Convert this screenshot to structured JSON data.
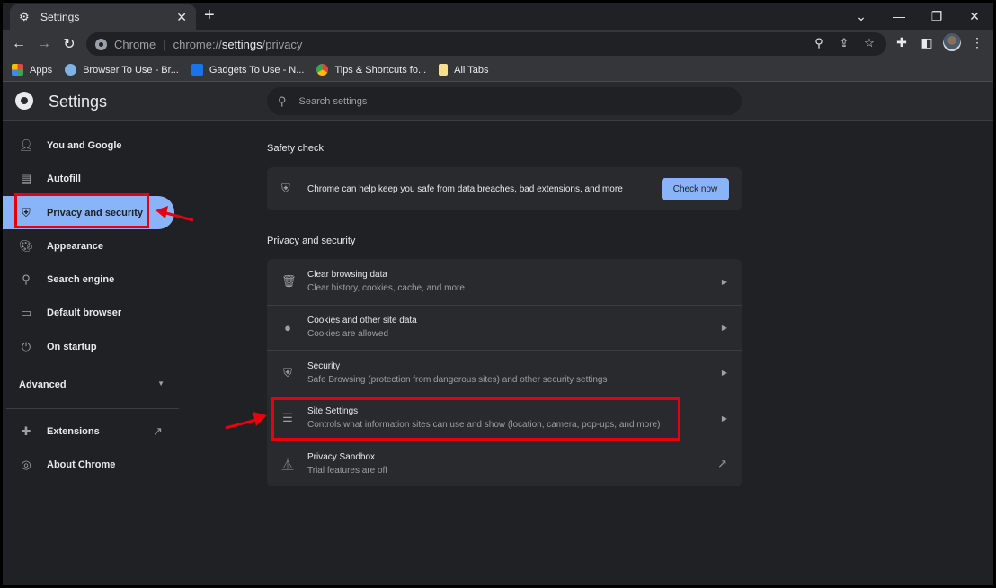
{
  "window": {
    "tab_title": "Settings",
    "tab_icon": "gear-icon",
    "controls": [
      "tab-search",
      "minimize",
      "restore",
      "close"
    ]
  },
  "toolbar": {
    "origin_label": "Chrome",
    "url_prefix": "chrome://",
    "url_host": "settings",
    "url_path": "/privacy"
  },
  "bookmarks": [
    {
      "label": "Apps",
      "icon": "apps-grid-icon",
      "color": "#e8453c"
    },
    {
      "label": "Browser To Use - Br...",
      "icon": "globe-icon",
      "color": "#7fb2e5"
    },
    {
      "label": "Gadgets To Use - N...",
      "icon": "gtu-icon",
      "color": "#1a73e8"
    },
    {
      "label": "Tips & Shortcuts fo...",
      "icon": "chrome-icon",
      "color": "#f4b400"
    },
    {
      "label": "All Tabs",
      "icon": "folder-icon",
      "color": "#f7e08a"
    }
  ],
  "header": {
    "title": "Settings",
    "search_placeholder": "Search settings"
  },
  "sidebar": {
    "items": [
      {
        "label": "You and Google",
        "icon": "person-icon"
      },
      {
        "label": "Autofill",
        "icon": "clipboard-icon"
      },
      {
        "label": "Privacy and security",
        "icon": "shield-icon",
        "active": true
      },
      {
        "label": "Appearance",
        "icon": "palette-icon"
      },
      {
        "label": "Search engine",
        "icon": "search-icon"
      },
      {
        "label": "Default browser",
        "icon": "browser-icon"
      },
      {
        "label": "On startup",
        "icon": "power-icon"
      }
    ],
    "advanced_label": "Advanced",
    "extensions_label": "Extensions",
    "about_label": "About Chrome"
  },
  "safety_check": {
    "heading": "Safety check",
    "text": "Chrome can help keep you safe from data breaches, bad extensions, and more",
    "button": "Check now"
  },
  "privacy": {
    "heading": "Privacy and security",
    "rows": [
      {
        "title": "Clear browsing data",
        "subtitle": "Clear history, cookies, cache, and more",
        "icon": "trash-icon",
        "action": "chevron"
      },
      {
        "title": "Cookies and other site data",
        "subtitle": "Cookies are allowed",
        "icon": "cookie-icon",
        "action": "chevron"
      },
      {
        "title": "Security",
        "subtitle": "Safe Browsing (protection from dangerous sites) and other security settings",
        "icon": "shield-icon",
        "action": "chevron"
      },
      {
        "title": "Site Settings",
        "subtitle": "Controls what information sites can use and show (location, camera, pop-ups, and more)",
        "icon": "tune-icon",
        "action": "chevron"
      },
      {
        "title": "Privacy Sandbox",
        "subtitle": "Trial features are off",
        "icon": "flask-icon",
        "action": "external"
      }
    ]
  },
  "annotations": {
    "highlight_color": "#e8000b"
  }
}
